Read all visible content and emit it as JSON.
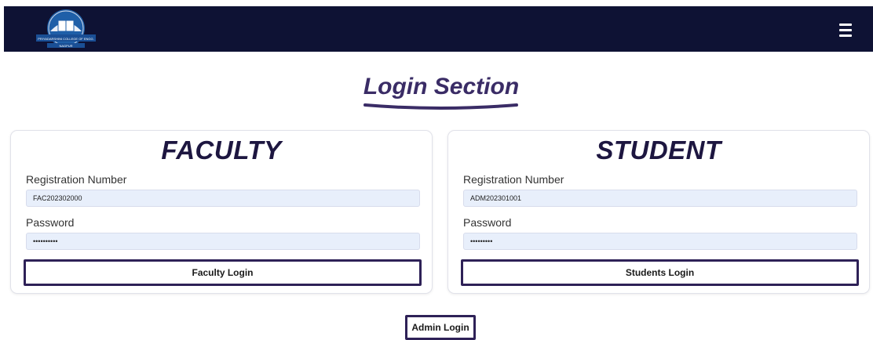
{
  "header": {
    "logo_text": "PRIYADARSHINI COLLEGE OF ENGG. NAGPUR",
    "menu_icon": "hamburger-icon"
  },
  "page": {
    "title": "Login Section"
  },
  "faculty": {
    "title": "FACULTY",
    "reg_label": "Registration Number",
    "reg_value": "FAC202302000",
    "password_label": "Password",
    "password_value": "••••••••••",
    "login_label": "Faculty Login"
  },
  "student": {
    "title": "STUDENT",
    "reg_label": "Registration Number",
    "reg_value": "ADM202301001",
    "password_label": "Password",
    "password_value": "•••••••••",
    "login_label": "Students Login"
  },
  "admin": {
    "login_label": "Admin Login"
  },
  "colors": {
    "navbar": "#0e1234",
    "accent": "#3a2c66",
    "input_bg": "#e8effb",
    "button_border": "#2e2157"
  }
}
